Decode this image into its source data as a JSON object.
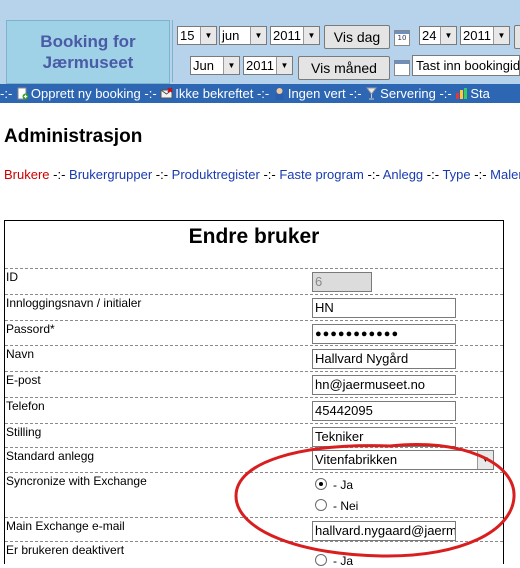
{
  "brand": {
    "title": "Booking for\nJærmuseet"
  },
  "controls": {
    "from_day": "15",
    "from_month": "jun",
    "from_year": "2011",
    "today_button": "Vis dag",
    "to_day": "24",
    "to_year": "2011",
    "month_select": "Jun",
    "month_year": "2011",
    "month_button": "Vis måned",
    "search_text": "Tast inn bookingid"
  },
  "navbar": {
    "items": [
      {
        "label": "Opprett ny booking"
      },
      {
        "label": "Ikke bekreftet"
      },
      {
        "label": "Ingen vert"
      },
      {
        "label": "Servering"
      },
      {
        "label": "Sta"
      }
    ],
    "separator": "-:-"
  },
  "page": {
    "heading": "Administrasjon"
  },
  "admin_links": {
    "items": [
      {
        "label": "Brukere"
      },
      {
        "label": "Brukergrupper"
      },
      {
        "label": "Produktregister"
      },
      {
        "label": "Faste program"
      },
      {
        "label": "Anlegg"
      },
      {
        "label": "Type"
      },
      {
        "label": "Maler"
      }
    ],
    "separator": "-:-"
  },
  "form": {
    "title": "Endre bruker",
    "fields": [
      {
        "label": "ID",
        "value": "6"
      },
      {
        "label": "Innloggingsnavn / initialer",
        "value": "HN"
      },
      {
        "label": "Passord*",
        "value": "●●●●●●●●●●●"
      },
      {
        "label": "Navn",
        "value": "Hallvard Nygård"
      },
      {
        "label": "E-post",
        "value": "hn@jaermuseet.no"
      },
      {
        "label": "Telefon",
        "value": "45442095"
      },
      {
        "label": "Stilling",
        "value": "Tekniker"
      },
      {
        "label": "Standard anlegg",
        "value": "Vitenfabrikken"
      },
      {
        "label": "Syncronize with Exchange",
        "option_yes": "- Ja",
        "option_no": "- Nei"
      },
      {
        "label": "Main Exchange e-mail",
        "value": "hallvard.nygaard@jaermu"
      },
      {
        "label": "Er brukeren deaktivert",
        "option_yes": "- Ja"
      }
    ]
  },
  "colors": {
    "header_bg": "#b7d3ec",
    "nav_bg": "#2d66b3",
    "link": "#1a3bb0",
    "active_link": "#cc0000",
    "annotation": "#d81e1e"
  }
}
